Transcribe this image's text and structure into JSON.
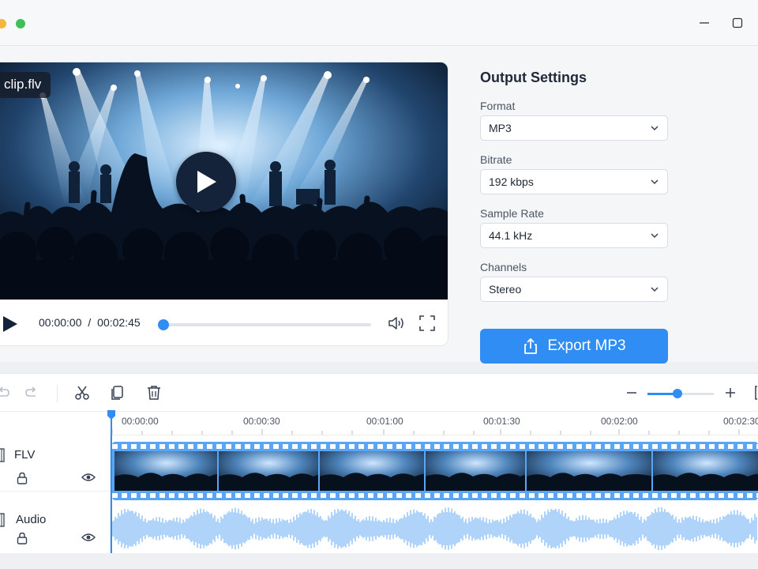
{
  "player": {
    "file_name": "clip.flv",
    "current_time": "00:00:00",
    "separator": "/",
    "duration": "00:02:45",
    "progress": 0
  },
  "settings": {
    "title": "Output Settings",
    "fields": [
      {
        "label": "Format",
        "value": "MP3"
      },
      {
        "label": "Bitrate",
        "value": "192 kbps"
      },
      {
        "label": "Sample Rate",
        "value": "44.1 kHz"
      },
      {
        "label": "Channels",
        "value": "Stereo"
      }
    ],
    "export_label": "Export MP3"
  },
  "timeline": {
    "ruler": [
      "00:00:00",
      "00:00:30",
      "00:01:00",
      "00:01:30",
      "00:02:00",
      "00:02:30"
    ],
    "tracks": [
      {
        "name": "FLV"
      },
      {
        "name": "Audio"
      }
    ],
    "zoom_level": 0.45
  },
  "colors": {
    "accent": "#2f8df3",
    "track": "#5aa5f4",
    "dark": "#14223a"
  }
}
